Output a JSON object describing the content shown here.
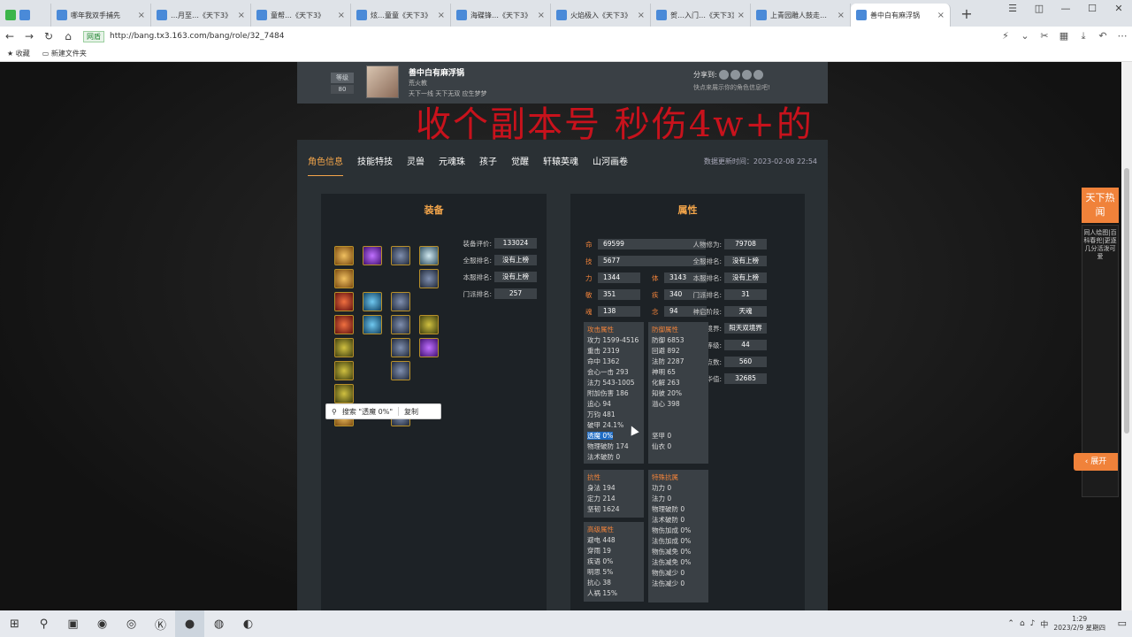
{
  "browser": {
    "tabs": [
      {
        "label": "哪年我双手捕先"
      },
      {
        "label": "…月至…《天下3》"
      },
      {
        "label": "童帮…《天下3》"
      },
      {
        "label": "炫…童童《天下3》"
      },
      {
        "label": "海碟锋…《天下3》"
      },
      {
        "label": "火焰极入《天下3》"
      },
      {
        "label": "贺…入门…《天下3》"
      },
      {
        "label": "上青园雕人鼓走…"
      },
      {
        "label": "善中白有麻浮锅"
      }
    ],
    "new_tab": "+",
    "url": "http://bang.tx3.163.com/bang/role/32_7484",
    "security_badge": "网盾",
    "bookmarks": [
      "收藏",
      "新建文件夹"
    ]
  },
  "overlay_caption": "收个副本号  秒伤4w+的",
  "profile": {
    "level_label": "等级",
    "level": "80",
    "name": "善中白有麻浮锅",
    "school": "荒火教",
    "motto": "天下一线 天下无双 应生梦梦",
    "share_label": "分享到:",
    "share_tip": "快点来展示你的角色信息吧!"
  },
  "nav_tabs": [
    {
      "label": "角色信息",
      "active": true
    },
    {
      "label": "技能特技"
    },
    {
      "label": "灵兽"
    },
    {
      "label": "元魂珠"
    },
    {
      "label": "孩子"
    },
    {
      "label": "觉醒"
    },
    {
      "label": "轩辕英魂"
    },
    {
      "label": "山河画卷"
    }
  ],
  "update_time": "数据更新时间：2023-02-08 22:54",
  "equipment": {
    "title": "装备",
    "stats": [
      {
        "label": "装备评价:",
        "value": "133024"
      },
      {
        "label": "全服排名:",
        "value": "没有上榜"
      },
      {
        "label": "本服排名:",
        "value": "没有上榜"
      },
      {
        "label": "门派排名:",
        "value": "257"
      }
    ]
  },
  "attributes": {
    "title": "属性",
    "main": [
      {
        "label": "命",
        "value": "69599"
      },
      {
        "label": "技",
        "value": "5677"
      }
    ],
    "grid": [
      {
        "label": "力",
        "value": "1344"
      },
      {
        "label": "体",
        "value": "3143"
      },
      {
        "label": "敏",
        "value": "351"
      },
      {
        "label": "疾",
        "value": "340"
      },
      {
        "label": "魂",
        "value": "138"
      },
      {
        "label": "念",
        "value": "94"
      }
    ],
    "side": [
      {
        "label": "人物修为:",
        "value": "79708"
      },
      {
        "label": "全服排名:",
        "value": "没有上榜"
      },
      {
        "label": "本服排名:",
        "value": "没有上榜"
      },
      {
        "label": "门派排名:",
        "value": "31"
      },
      {
        "label": "神启阶段:",
        "value": "天魂"
      },
      {
        "label": "神启境界:",
        "value": "阳天双境界"
      },
      {
        "label": "四象等级:",
        "value": "44"
      },
      {
        "label": "天赏点数:",
        "value": "560"
      },
      {
        "label": "风华值:",
        "value": "32685"
      }
    ],
    "attack": {
      "title": "攻击属性",
      "items": [
        "攻力 1599-4516",
        "重击 2319",
        "命中 1362",
        "会心一击 293",
        "法力 543-1005",
        "附加伤害 186",
        "追心 94",
        "万钧 481",
        "破甲 24.1%",
        "透魔 0%",
        "物理破防 174",
        "法术破防 0"
      ]
    },
    "defense": {
      "title": "防御属性",
      "items": [
        "防御 6853",
        "回避 892",
        "法防 2287",
        "神明 65",
        "化解 263",
        "知彼 20%",
        "溢心 398",
        "",
        "",
        "坚甲 0",
        "仙衣 0"
      ]
    },
    "resist": {
      "title": "抗性",
      "items": [
        "身法 194",
        "定力 214",
        "坚韧 1624"
      ]
    },
    "advanced": {
      "title": "高级属性",
      "items": [
        "避电 448",
        "穿雨 19",
        "疾语 0%",
        "明思 5%",
        "抗心 38",
        "人祸 15%"
      ]
    },
    "special": {
      "title": "特殊抗属",
      "items": [
        "功力 0",
        "法力 0",
        "物理破防 0",
        "法术破防 0",
        "物伤加成 0%",
        "法伤加成 0%",
        "物伤减免 0%",
        "法伤减免 0%",
        "物伤减少 0",
        "法伤减少 0"
      ]
    }
  },
  "context_popup": {
    "search": "搜索 \"透魔 0%\"",
    "copy": "复制"
  },
  "hot_news": {
    "title": "天下热闻",
    "list": "同人绘图|百科春兜|更逐几分活泼可爱",
    "expand": "展开"
  },
  "taskbar": {
    "time": "1:29",
    "date": "2023/2/9 星期四",
    "ime": "中"
  }
}
